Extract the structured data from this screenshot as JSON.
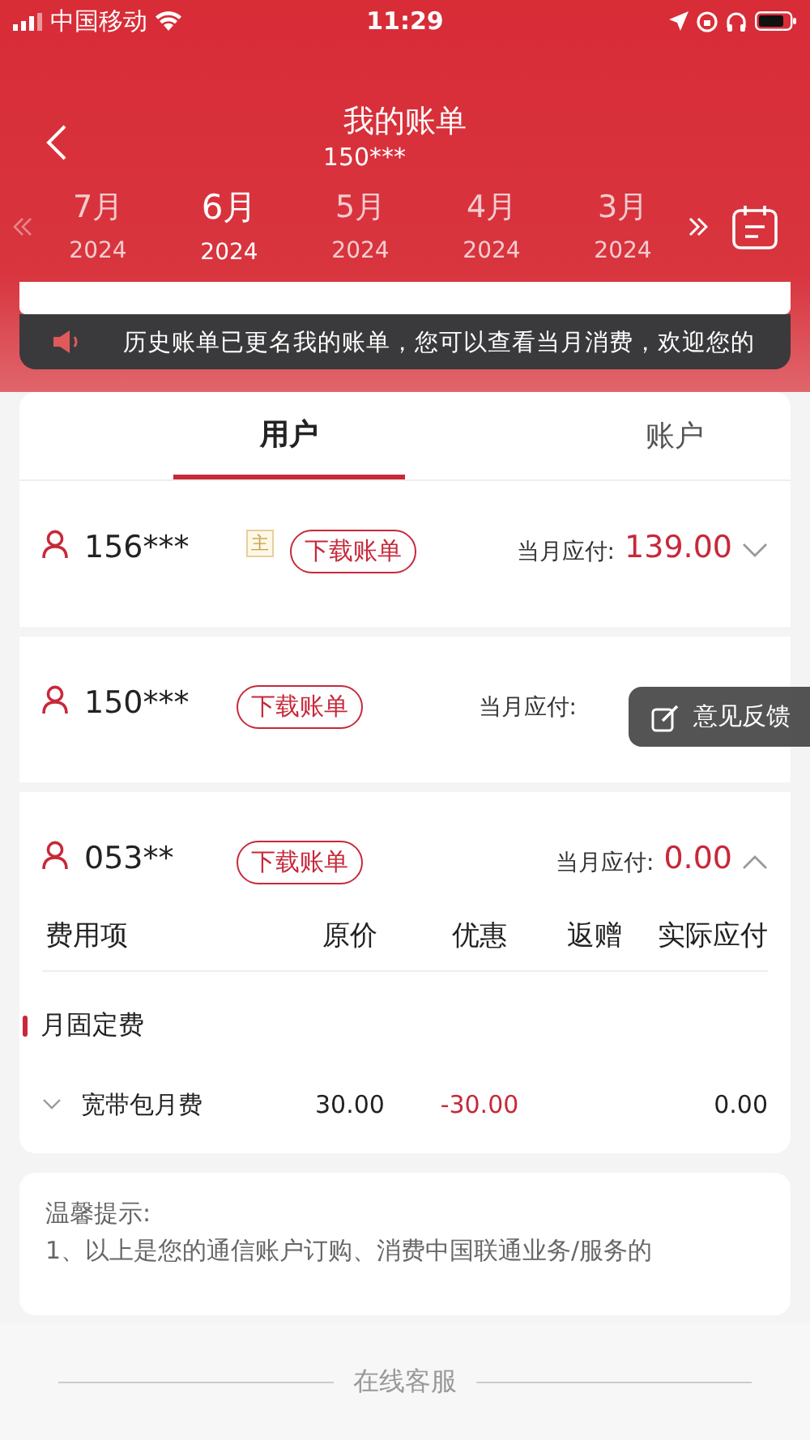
{
  "status_bar": {
    "carrier": "中国移动",
    "time": "11:29"
  },
  "header": {
    "title": "我的账单",
    "subtitle": "150***"
  },
  "months": [
    {
      "month": "7月",
      "year": "2024",
      "selected": false
    },
    {
      "month": "6月",
      "year": "2024",
      "selected": true
    },
    {
      "month": "5月",
      "year": "2024",
      "selected": false
    },
    {
      "month": "4月",
      "year": "2024",
      "selected": false
    },
    {
      "month": "3月",
      "year": "2024",
      "selected": false
    }
  ],
  "notice": "历史账单已更名我的账单，您可以查看当月消费，欢迎您的",
  "tabs": [
    {
      "label": "用户",
      "selected": true
    },
    {
      "label": "账户",
      "selected": false
    }
  ],
  "accounts": [
    {
      "number": "156***",
      "badge": "主",
      "button": "下载账单",
      "due_label": "当月应付:",
      "amount": "139.00",
      "expanded": false
    },
    {
      "number": "150***",
      "button": "下载账单",
      "due_label": "当月应付:"
    },
    {
      "number": "053**",
      "button": "下载账单",
      "due_label": "当月应付:",
      "amount": "0.00",
      "expanded": true
    }
  ],
  "fee_table": {
    "columns": [
      "费用项",
      "原价",
      "优惠",
      "返赠",
      "实际应付"
    ],
    "group": "月固定费",
    "rows": [
      {
        "name": "宽带包月费",
        "original": "30.00",
        "discount": "-30.00",
        "actual": "0.00"
      }
    ]
  },
  "tips": {
    "title": "温馨提示:",
    "text": "1、以上是您的通信账户订购、消费中国联通业务/服务的"
  },
  "footer": {
    "label": "在线客服"
  },
  "feedback": {
    "label": "意见反馈"
  }
}
